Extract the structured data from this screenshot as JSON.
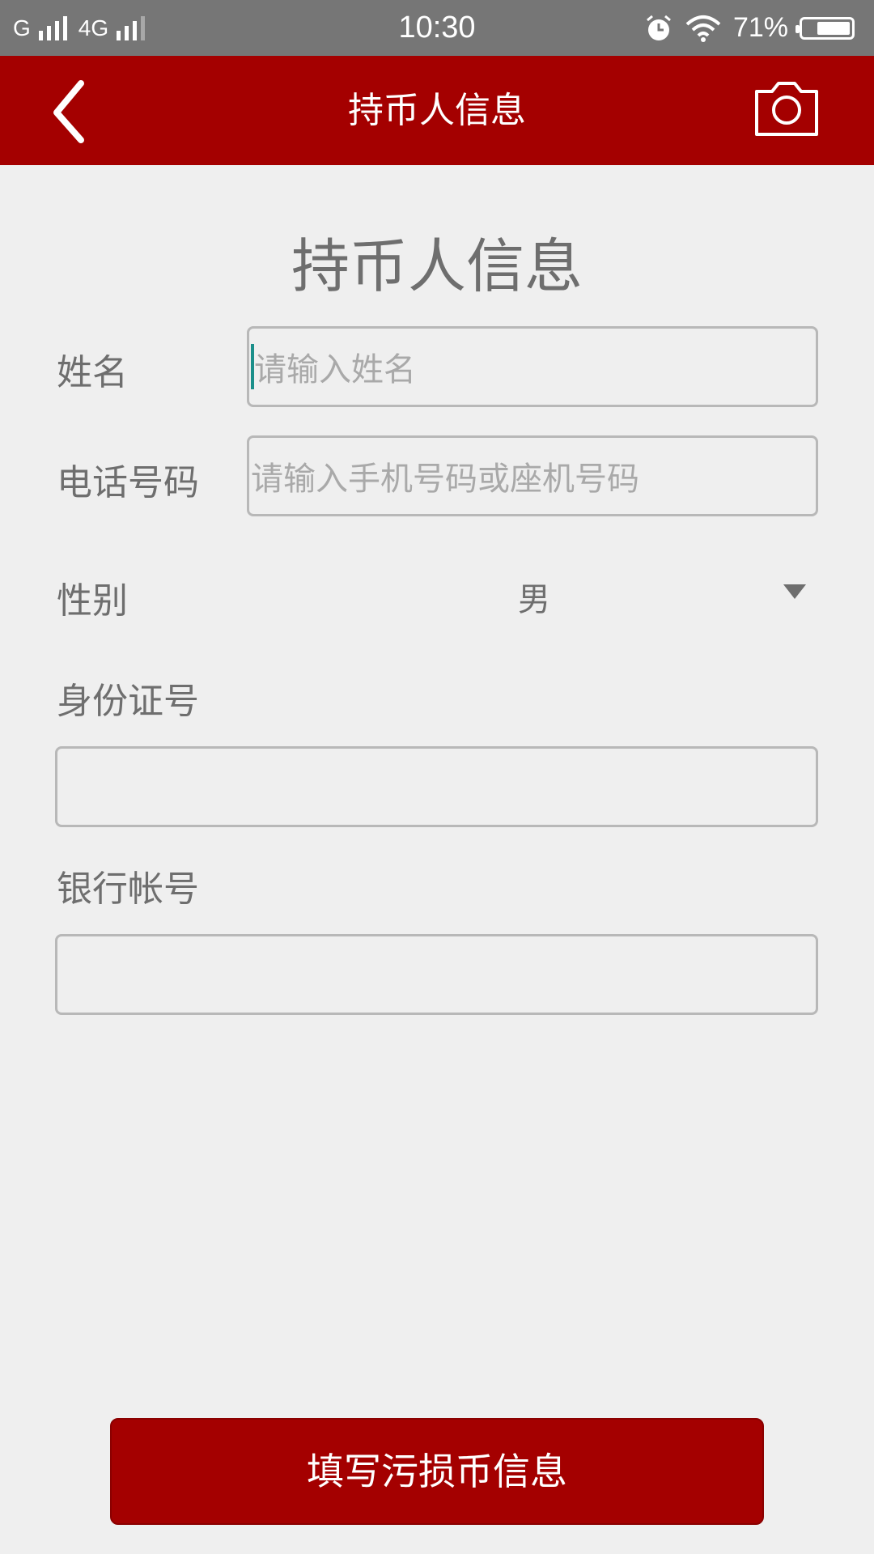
{
  "status_bar": {
    "carrier1": "G",
    "carrier2": "4G",
    "time": "10:30",
    "battery": "71%",
    "battery_level": 0.71
  },
  "header": {
    "title": "持币人信息",
    "back_icon": "chevron-left-icon",
    "camera_icon": "camera-icon"
  },
  "form": {
    "heading": "持币人信息",
    "name_label": "姓名",
    "name_placeholder": "请输入姓名",
    "phone_label": "电话号码",
    "phone_placeholder": "请输入手机号码或座机号码",
    "gender_label": "性别",
    "gender_value": "男",
    "id_label": "身份证号",
    "id_value": "",
    "bank_label": "银行帐号",
    "bank_value": ""
  },
  "submit": {
    "label": "填写污损币信息"
  },
  "colors": {
    "brand": "#a40000",
    "status_bar": "#767676",
    "background": "#efefef"
  }
}
